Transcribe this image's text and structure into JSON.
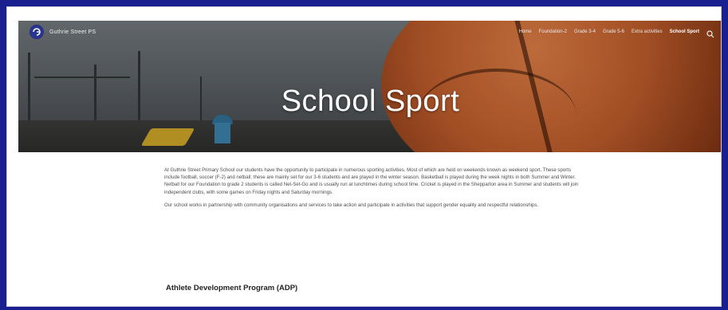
{
  "site": {
    "brand_name": "Guthrie Street PS",
    "logo_icon": "school-logo-icon",
    "brand_color": "#1a1f8f"
  },
  "nav": {
    "items": [
      {
        "label": "Home"
      },
      {
        "label": "Foundation-2"
      },
      {
        "label": "Grade 3-4"
      },
      {
        "label": "Grade 5-6"
      },
      {
        "label": "Extra activities"
      },
      {
        "label": "School Sport",
        "active": true
      }
    ],
    "search_icon": "search-icon"
  },
  "hero": {
    "title": "School Sport"
  },
  "content": {
    "paragraphs": [
      "At Guthrie Street Primary School our students have the opportunity to participate in numerous sporting activities. Most of which are held on weekends known as weekend sport. These sports include football, soccer (F-2) and netball; these are mainly set for our 3-6 students and are played in the winter season. Basketball is played during the week nights in both Summer and Winter. Netball for our Foundation to grade 2 students is called Net-Set-Go and is usually run at lunchtimes during school time. Cricket is played in the Shepparton area in Summer and students will join independent clubs, with some games on Friday nights and Saturday mornings.",
      "Our school works in partnership with community organisations and services to take action and participate in activities that support gender equality and respectful relationships."
    ],
    "section_heading": "Athlete Development Program (ADP)"
  }
}
